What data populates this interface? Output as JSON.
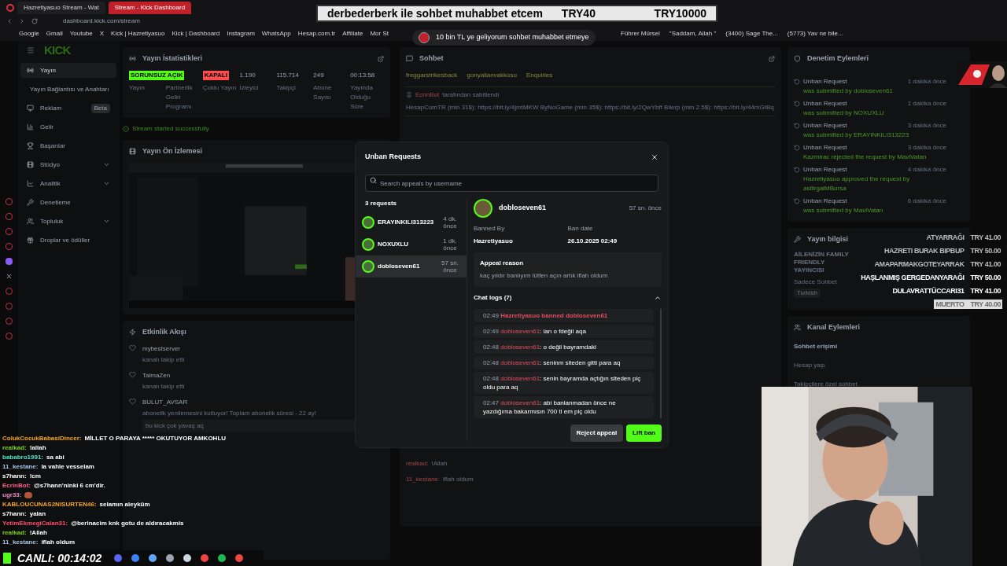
{
  "browser": {
    "tabs": [
      {
        "label": "Hazretiyasuo Stream - Wat",
        "selected": false
      },
      {
        "label": "Stream - Kick Dashboard",
        "selected": true
      }
    ],
    "url": "dashboard.kick.com/stream",
    "bookmarks": [
      "Google",
      "Gmail",
      "Youtube",
      "X",
      "Kick | Hazretiyasuo",
      "Kick | Dashboard",
      "Instagram",
      "WhatsApp",
      "Hesap.com.tr",
      "Affiliate",
      "Mor St"
    ],
    "bookmarks_right": [
      "Führer Mürsel",
      "\"Saddam, Allah \"",
      "(3400) Sage The...",
      "(5773) Yav ne bile..."
    ]
  },
  "goal_banner": {
    "text": "derbederberk ile sohbet muhabbet etcem",
    "amount": "TRY40",
    "goal": "TRY10000"
  },
  "notification": {
    "text": "10 bin TL ye geliyorum sohbet muhabbet etmeye"
  },
  "sidebar": {
    "logo": "KICK",
    "items": [
      {
        "label": "Yayın",
        "selected": true,
        "kind": "item"
      },
      {
        "label": "Yayın Bağlantısı ve Anahtarı",
        "selected": false,
        "kind": "sub"
      },
      {
        "label": "Reklam",
        "badge": "Beta",
        "selected": false,
        "kind": "item"
      },
      {
        "label": "Gelir",
        "selected": false,
        "kind": "item"
      },
      {
        "label": "Başarılar",
        "selected": false,
        "kind": "item"
      },
      {
        "label": "Stüdyo",
        "selected": false,
        "kind": "group"
      },
      {
        "label": "Analitik",
        "selected": false,
        "kind": "group"
      },
      {
        "label": "Denetleme",
        "selected": false,
        "kind": "item"
      },
      {
        "label": "Topluluk",
        "selected": false,
        "kind": "group"
      },
      {
        "label": "Droplar ve ödüller",
        "selected": false,
        "kind": "item"
      }
    ]
  },
  "stats_panel": {
    "title": "Yayın İstatistikleri",
    "stats": [
      {
        "value": "SORUNSUZ",
        "label": "Yayın",
        "kind": "badge",
        "color": "#53fc18"
      },
      {
        "value": "AÇIK",
        "label": "Partnerlik Geliri Programı",
        "kind": "badge",
        "color": "#53fc18"
      },
      {
        "value": "KAPALI",
        "label": "Çoklu Yayın",
        "kind": "badge",
        "color": "#ff4d4d"
      },
      {
        "value": "1.190",
        "label": "İzleyici",
        "kind": "number"
      },
      {
        "value": "115.714",
        "label": "Takipçi",
        "kind": "number"
      },
      {
        "value": "249",
        "label": "Abone Sayısı",
        "kind": "number"
      },
      {
        "value": "00:13:58",
        "label": "Yayında Olduğu Süre",
        "kind": "number"
      }
    ],
    "success": "Stream started successfully"
  },
  "preview_panel": {
    "title": "Yayın Ön İzlemesi"
  },
  "activity_panel": {
    "title": "Etkinlik Akışı",
    "items": [
      {
        "user": "mybestserver",
        "text": "kanalı takip etti"
      },
      {
        "user": "TalmaZen",
        "text": "kanalı takip etti"
      },
      {
        "user": "BULUT_AVSAR",
        "text": "abonelik yenilemesini kutluyor! Toplam abonelik süresi - 22 ay!",
        "message": "bu kick çok yavaş aq"
      }
    ]
  },
  "chat_panel": {
    "title": "Sohbet",
    "chips": [
      "freggarstrikesback",
      "gonyalianvakkosu",
      "Enquiries"
    ],
    "pinned_by": "EcrinBot",
    "pinned_label": "tarafından sabitlendi",
    "pinned_text": "HesapComTR (min 31$): https://bit.ly/4jmtMKW ByNoGame (min 35$): https://bit.ly/2QwYbft Bilerp (min 2.5$): https://bit.ly/44mGtBq",
    "separator": ":",
    "messages": [
      {
        "user": "realkad",
        "text": "!Allah"
      },
      {
        "user": "11_kestane",
        "text": "iflah oldum"
      }
    ]
  },
  "moderation_panel": {
    "title": "Denetim Eylemleri",
    "items": [
      {
        "title": "Unban Request",
        "text": "was submitted by dobloseven61",
        "time": "1 dakika önce"
      },
      {
        "title": "Unban Request",
        "text": "was submitted by NOXUXLU",
        "time": "1 dakika önce"
      },
      {
        "title": "Unban Request",
        "text": "was submitted by ERAYINKILI313223",
        "time": "3 dakika önce"
      },
      {
        "title": "Unban Request",
        "text": "Kazmirac rejected the request by MaviVatan",
        "time": "3 dakika önce"
      },
      {
        "title": "Unban Request",
        "text": "Hazretiyasuo approved the request by asilirgalMBursa",
        "time": "4 dakika önce"
      },
      {
        "title": "Unban Request",
        "text": "was submitted by MaviVatan",
        "time": "6 dakika önce"
      }
    ]
  },
  "info_panel": {
    "title": "Yayın bilgisi",
    "stream_title": "AİLENİZİN FAMILY FRIENDLY YAYINCISI",
    "category": "Sadece Sohbet",
    "tag": "Turkish"
  },
  "channel_panel": {
    "title": "Kanal Eylemleri",
    "section": "Sohbet erişimi",
    "rows": [
      "Hesap yaşı",
      "Takipçilere özel sohbet"
    ]
  },
  "donations": [
    {
      "name": "ATYARRAĞI",
      "amount": "TRY 41.00",
      "selected": false
    },
    {
      "name": "HAZRETI BURAK BIPBUP",
      "amount": "TRY 50.00",
      "selected": false
    },
    {
      "name": "AMAPARMAKGOTEYARRAK",
      "amount": "TRY 41.00",
      "selected": false
    },
    {
      "name": "HAŞLANMIŞ GERGEDANYARAĞI",
      "amount": "TRY 50.00",
      "selected": false
    },
    {
      "name": "DULAVRATTÜCCARI31",
      "amount": "TRY 41.00",
      "selected": false
    },
    {
      "name": "MUERTO",
      "amount": "TRY 40.00",
      "selected": true
    }
  ],
  "stream_chat": {
    "separator": ":",
    "messages": [
      {
        "user": "ColukCocukBabasiDincer",
        "color": "#f5a623",
        "text": "MİLLET O PARAYA ***** OKUTUYOR AMKOHLU"
      },
      {
        "user": "realkad",
        "color": "#7ed321",
        "text": "!allah"
      },
      {
        "user": "bababro1991",
        "color": "#50e3c2",
        "text": "sa abi"
      },
      {
        "user": "11_kestane",
        "color": "#a9c4e6",
        "text": "la vahle vesselam"
      },
      {
        "user": "s7hann",
        "color": "#ffffff",
        "text": "!cm"
      },
      {
        "user": "EcrinBot",
        "color": "#ff5c8a",
        "text": "@s7hann'ninki 6 cm'dir."
      },
      {
        "user": "ugr33",
        "color": "#e88bc4",
        "kind": "emote"
      },
      {
        "user": "KABLOUCUNAS2NISURTEN46",
        "color": "#f5a623",
        "text": "selamın aleyküm"
      },
      {
        "user": "s7hann",
        "color": "#ffffff",
        "text": "yalan"
      },
      {
        "user": "YetimEkmegiCalan31",
        "color": "#ff4d6d",
        "text": "@berinacim knk gotu de aldıracakmis"
      },
      {
        "user": "realkad",
        "color": "#7ed321",
        "text": "!Allah"
      },
      {
        "user": "11_kestane",
        "color": "#a9c4e6",
        "text": "iflah oldum"
      }
    ]
  },
  "live_timer": {
    "label": "CANLI:",
    "time": "00:14:02"
  },
  "modal": {
    "title": "Unban Requests",
    "search_placeholder": "Search appeals by username",
    "count": "3 requests",
    "requests": [
      {
        "name": "ERAYINKILI313223",
        "time": "4 dk. önce",
        "selected": false
      },
      {
        "name": "NOXUXLU",
        "time": "1 dk. önce",
        "selected": false
      },
      {
        "name": "dobloseven61",
        "time": "57 sn. önce",
        "selected": true
      }
    ],
    "detail": {
      "name": "dobloseven61",
      "time": "57 sn. önce",
      "banned_by_label": "Banned By",
      "banned_by": "Hazretiyasuo",
      "ban_date_label": "Ban date",
      "ban_date": "26.10.2025 02:49",
      "reason_label": "Appeal reason",
      "reason": "kaç yıldır banlıyım lütfen açın artık iflah oldum",
      "logs_title": "Chat logs (7)",
      "logs_expanded": true,
      "separator": ":",
      "logs": [
        {
          "kind": "ban",
          "time": "02:49",
          "user": "Hazretiyasuo",
          "text": "banned dobloseven61"
        },
        {
          "kind": "message",
          "time": "02:49",
          "user": "dobloseven61",
          "text": "lan o fdeğil aqa"
        },
        {
          "kind": "message",
          "time": "02:48",
          "user": "dobloseven61",
          "text": "o değil bayramdaki"
        },
        {
          "kind": "message",
          "time": "02:48",
          "user": "dobloseven61",
          "text": "seninm siteden gitti para aq"
        },
        {
          "kind": "message",
          "time": "02:48",
          "user": "dobloseven61",
          "text": "senin bayramda açtığın siteden piç oldu para aq"
        },
        {
          "kind": "message",
          "time": "02:47",
          "user": "dobloseven61",
          "text": "abi banlanmadan önce ne yazdığıma bakarmısın 700 tl em piç oldu"
        }
      ]
    },
    "buttons": [
      {
        "label": "Reject appeal",
        "kind": "secondary"
      },
      {
        "label": "Lift ban",
        "kind": "primary"
      }
    ]
  }
}
